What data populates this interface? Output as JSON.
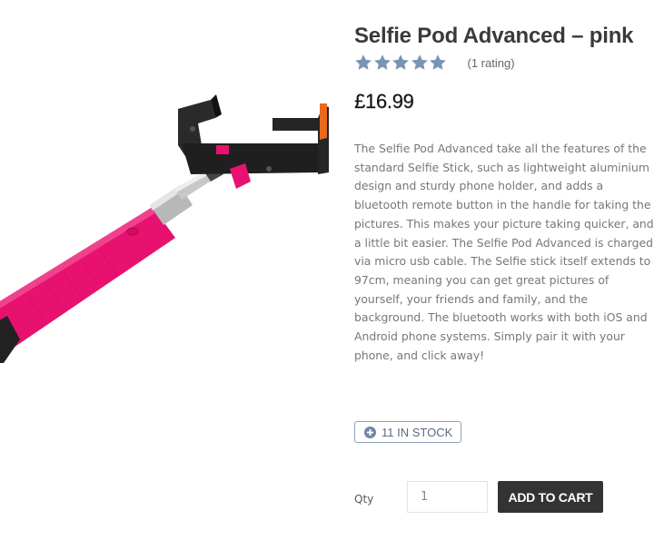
{
  "product": {
    "image_name": "pink selfie stick",
    "title": "Selfie Pod Advanced – pink",
    "rating": 5,
    "rating_max": 5,
    "rating_count_text": "(1 rating)",
    "price": "£16.99",
    "description": "The Selfie Pod Advanced take all the features of the standard Selfie Stick, such as lightweight aluminium design and sturdy phone holder, and adds a bluetooth remote button in the handle for taking the pictures. This makes your picture taking quicker, and a little bit easier. The Selfie Pod Advanced is charged via micro usb cable. The Selfie stick itself extends to 97cm, meaning you can get great pictures of yourself, your friends and family, and the background. The bluetooth works with both iOS and Android phone systems. Simply pair it with your phone, and click away!",
    "stock_text": "11 IN STOCK"
  },
  "cart": {
    "qty_label": "Qty",
    "qty_value": "1",
    "add_to_cart_label": "ADD TO CART"
  },
  "colors": {
    "star": "#7b93b4",
    "stock_border": "#8ea0b8",
    "button_bg": "#333333",
    "stick_pink": "#e8116f"
  }
}
